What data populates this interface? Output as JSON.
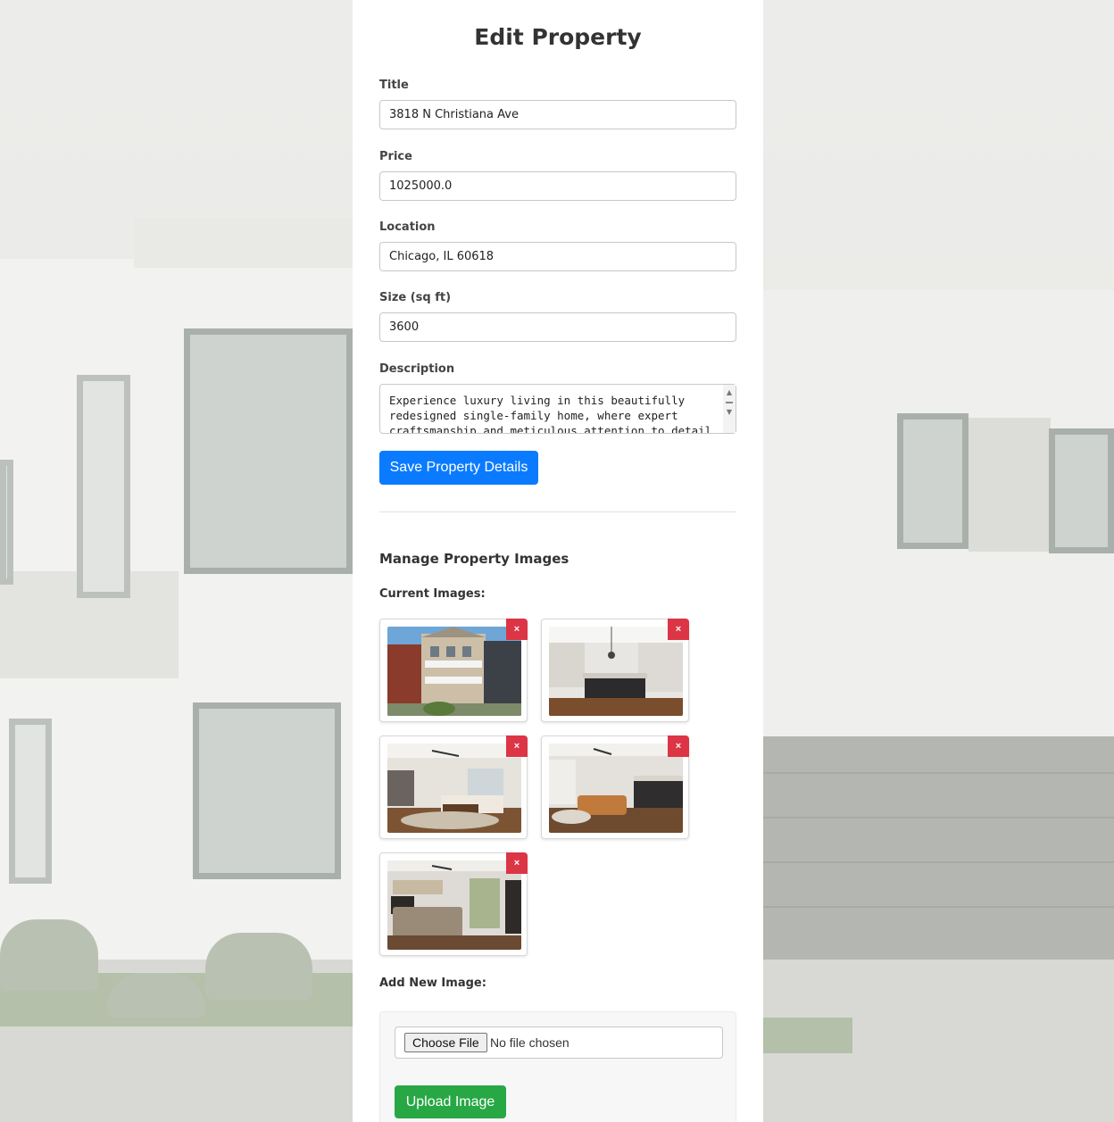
{
  "form": {
    "heading": "Edit Property",
    "fields": {
      "title": {
        "label": "Title",
        "value": "3818 N Christiana Ave"
      },
      "price": {
        "label": "Price",
        "value": "1025000.0"
      },
      "location": {
        "label": "Location",
        "value": "Chicago, IL 60618"
      },
      "size": {
        "label": "Size (sq ft)",
        "value": "3600"
      },
      "description": {
        "label": "Description",
        "value": "Experience luxury living in this beautifully redesigned single-family home, where expert craftsmanship and meticulous attention to detail"
      }
    },
    "save_label": "Save Property Details"
  },
  "images": {
    "section_title": "Manage Property Images",
    "current_label": "Current Images:",
    "delete_symbol": "×",
    "items": [
      {
        "subject": "house exterior"
      },
      {
        "subject": "kitchen"
      },
      {
        "subject": "living room"
      },
      {
        "subject": "family room"
      },
      {
        "subject": "bedroom"
      }
    ],
    "add_label": "Add New Image:",
    "choose_file_label": "Choose File",
    "no_file_text": "No file chosen",
    "upload_label": "Upload Image"
  },
  "colors": {
    "primary": "#0a7bff",
    "success": "#28a745",
    "danger": "#dc3545"
  }
}
